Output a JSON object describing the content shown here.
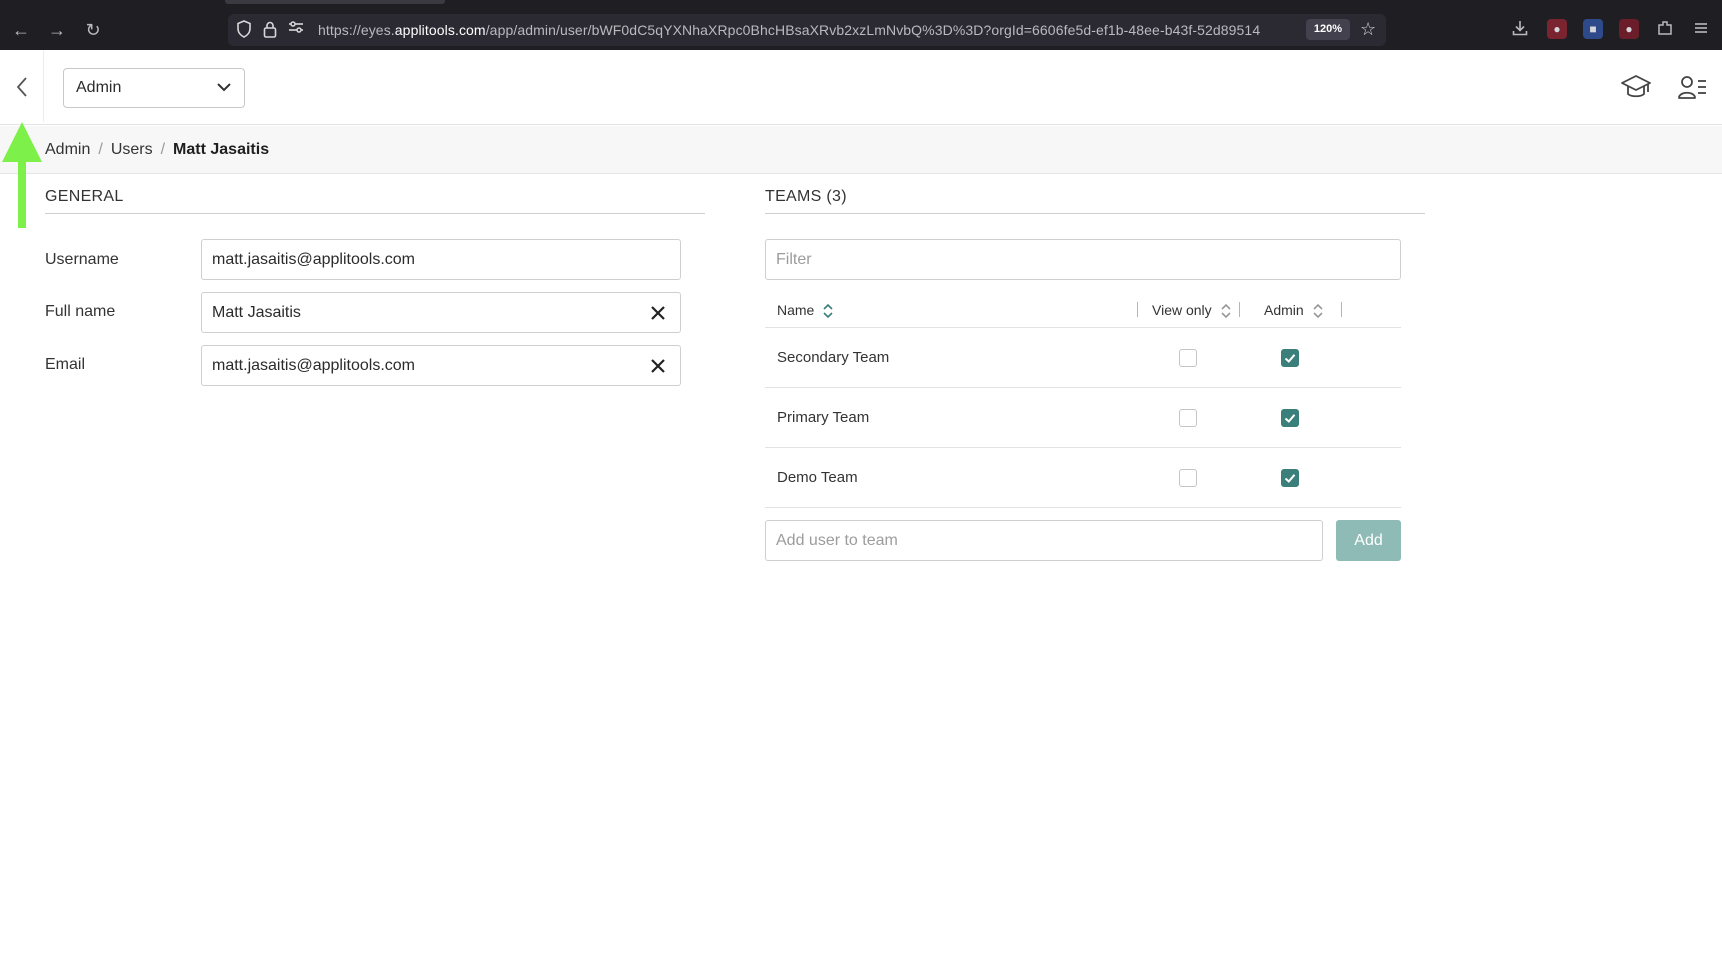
{
  "browser": {
    "url_prefix": "https://eyes.",
    "url_host": "applitools.com",
    "url_path": "/app/admin/user/bWF0dC5qYXNhaXRpc0BhcHBsaXRvb2xzLmNvbQ%3D%3D?orgId=6606fe5d-ef1b-48ee-b43f-52d89514",
    "zoom": "120%"
  },
  "header": {
    "section_select_value": "Admin"
  },
  "breadcrumb": {
    "items": [
      "Admin",
      "Users"
    ],
    "current": "Matt Jasaitis"
  },
  "general": {
    "title": "GENERAL",
    "fields": [
      {
        "label": "Username",
        "value": "matt.jasaitis@applitools.com"
      },
      {
        "label": "Full name",
        "value": "Matt Jasaitis"
      },
      {
        "label": "Email",
        "value": "matt.jasaitis@applitools.com"
      }
    ]
  },
  "teams": {
    "title": "TEAMS (3)",
    "filter_placeholder": "Filter",
    "columns": {
      "name": "Name",
      "view_only": "View only",
      "admin": "Admin"
    },
    "rows": [
      {
        "name": "Secondary Team",
        "view_only": false,
        "admin": true
      },
      {
        "name": "Primary Team",
        "view_only": false,
        "admin": true
      },
      {
        "name": "Demo Team",
        "view_only": false,
        "admin": true
      }
    ],
    "add_placeholder": "Add user to team",
    "add_label": "Add"
  },
  "colors": {
    "accent": "#3a7f79",
    "add_button": "#8fbbb7",
    "annotation_arrow": "#7ef04a"
  },
  "icons": [
    "back-arrow-icon",
    "forward-arrow-icon",
    "reload-icon",
    "shield-icon",
    "lock-icon",
    "permissions-icon",
    "star-icon",
    "download-icon",
    "extension-icon",
    "chevron-left-icon",
    "chevron-down-icon",
    "graduation-cap-icon",
    "user-list-icon",
    "close-icon",
    "sort-icon",
    "check-icon"
  ]
}
